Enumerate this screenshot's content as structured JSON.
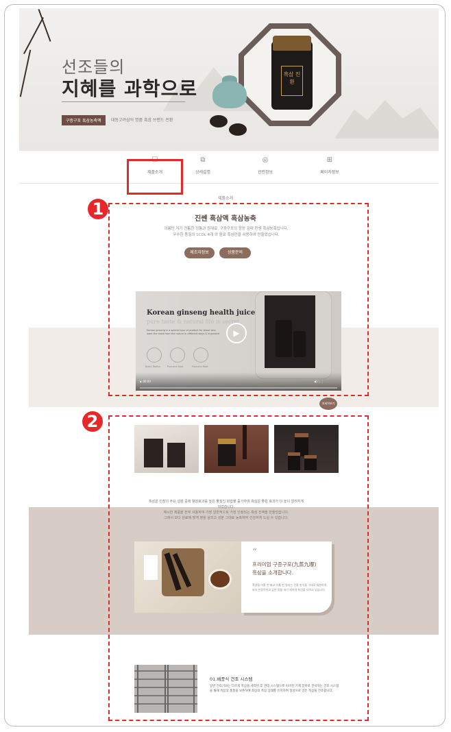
{
  "hero": {
    "title_line1": "선조들의",
    "title_line2": "지혜를 과학으로",
    "badge": "구증구포 흑삼농축액",
    "subtitle": "대동고려삼의 명품 흑삼 브랜드 진환",
    "jar_label": "흑삼 진환"
  },
  "tabs": [
    {
      "icon": "product-intro-icon",
      "glyph": "☐",
      "label": "제품소개",
      "active": true
    },
    {
      "icon": "detail-icon",
      "glyph": "⧉",
      "label": "상세설명",
      "active": false
    },
    {
      "icon": "related-info-icon",
      "glyph": "◎",
      "label": "관련정보",
      "active": false
    },
    {
      "icon": "page-info-icon",
      "glyph": "⊞",
      "label": "페이지정보",
      "active": false
    }
  ],
  "under_tab_label": "제품소개",
  "annotations": {
    "marker1": "1",
    "marker2": "2"
  },
  "section1": {
    "title": "진쎈 흑삼액 흑삼농축",
    "desc_line1": "이름만 저기 전통한 정통과 원재료. 구증구포의 정성 김태 진쎈 흑삼농축입니다.",
    "desc_line2": "우수한 품질의 1CDL 4개 의 원료 흑삼만을 사용하여 만들었습니다.",
    "button1": "제조자정보",
    "button2": "상품문의",
    "video": {
      "title": "Korean ginseng health juice",
      "subtitle": "pure taste & natural life is secret",
      "body": "Korean ginseng is a special type of product for those who want the most from the nature in different ways & improved",
      "herbs": [
        "Black Radish",
        "Pueraria Root",
        "Pueraria Root"
      ],
      "time": "▶ 00:00",
      "controls": "◀)  ⛶  ⋮"
    },
    "more_label": "자세히보기"
  },
  "section2": {
    "desc_line1": "흑삼은 인삼의 주요 성분 중에 항암효과를 높은 물질인 화합물 증가하여 흑삼은 좋은 효과가 더 높이 알려지게 되었습니다.",
    "desc_line2": "제시한 제품을 전부 사용하여 가장 일반적으로 가장 인정되는 흑삼 진액을 만들었습니다.",
    "desc_line3": "그래서 보다 원료에 맞게 향을 살리고 성분 그대로 농축하여 건강하게 드실 수 있습니다.",
    "feature": {
      "quote": "“",
      "title_line1": "프리미엄 구증구포(九蒸九曝)",
      "title_line2": "흑삼을 소개합니다.",
      "desc": "흑삼을 아홉 번 찌고 아홉 번 말리는 전통 방식을 그대로 재현하여 보다 안정적이고 깊은 맛을 내기 위하여 최선을 다하고 있습니다."
    },
    "system": {
      "title": "01.베풍식 건조 시스템",
      "desc": "일반 건조기와는 다르게 흑삼을 세척된 후 관리 시스템으로 이어진 기계 장비로 분석하는 건조 시스템을 통해 흑삼의 품질을 보존하여 최상의 흑삼 상태를 유지하여 정성으로 만든 흑삼을 건조합니다."
    }
  }
}
